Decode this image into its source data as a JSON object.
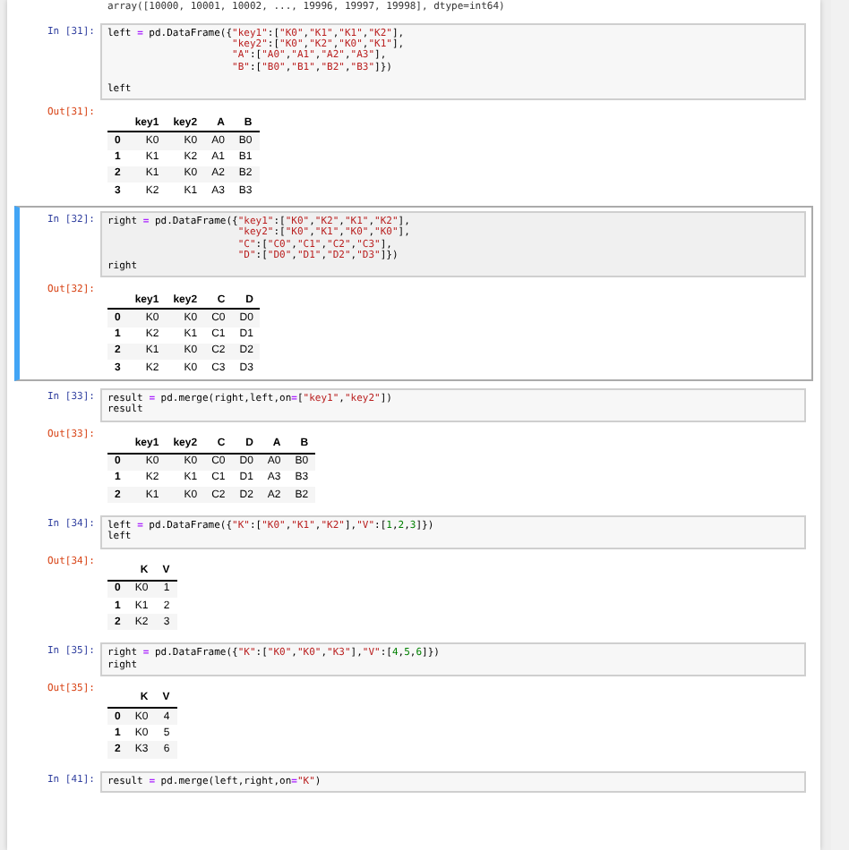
{
  "top_output": "array([10000, 10001, 10002, ..., 19996, 19997, 19998], dtype=int64)",
  "cells": [
    {
      "in_prompt": "In  [31]:",
      "selected": false,
      "code": "left = pd.DataFrame({\"key1\":[\"K0\",\"K1\",\"K1\",\"K2\"],\n                     \"key2\":[\"K0\",\"K2\",\"K0\",\"K1\"],\n                     \"A\":[\"A0\",\"A1\",\"A2\",\"A3\"],\n                     \"B\":[\"B0\",\"B1\",\"B2\",\"B3\"]})\n\nleft",
      "out_prompt": "Out[31]:",
      "table": {
        "columns": [
          "",
          "key1",
          "key2",
          "A",
          "B"
        ],
        "rows": [
          [
            "0",
            "K0",
            "K0",
            "A0",
            "B0"
          ],
          [
            "1",
            "K1",
            "K2",
            "A1",
            "B1"
          ],
          [
            "2",
            "K1",
            "K0",
            "A2",
            "B2"
          ],
          [
            "3",
            "K2",
            "K1",
            "A3",
            "B3"
          ]
        ]
      }
    },
    {
      "in_prompt": "In  [32]:",
      "selected": true,
      "code": "right = pd.DataFrame({\"key1\":[\"K0\",\"K2\",\"K1\",\"K2\"],\n                      \"key2\":[\"K0\",\"K1\",\"K0\",\"K0\"],\n                      \"C\":[\"C0\",\"C1\",\"C2\",\"C3\"],\n                      \"D\":[\"D0\",\"D1\",\"D2\",\"D3\"]})\nright",
      "out_prompt": "Out[32]:",
      "table": {
        "columns": [
          "",
          "key1",
          "key2",
          "C",
          "D"
        ],
        "rows": [
          [
            "0",
            "K0",
            "K0",
            "C0",
            "D0"
          ],
          [
            "1",
            "K2",
            "K1",
            "C1",
            "D1"
          ],
          [
            "2",
            "K1",
            "K0",
            "C2",
            "D2"
          ],
          [
            "3",
            "K2",
            "K0",
            "C3",
            "D3"
          ]
        ]
      }
    },
    {
      "in_prompt": "In  [33]:",
      "selected": false,
      "code": "result = pd.merge(right,left,on=[\"key1\",\"key2\"])\nresult",
      "out_prompt": "Out[33]:",
      "table": {
        "columns": [
          "",
          "key1",
          "key2",
          "C",
          "D",
          "A",
          "B"
        ],
        "rows": [
          [
            "0",
            "K0",
            "K0",
            "C0",
            "D0",
            "A0",
            "B0"
          ],
          [
            "1",
            "K2",
            "K1",
            "C1",
            "D1",
            "A3",
            "B3"
          ],
          [
            "2",
            "K1",
            "K0",
            "C2",
            "D2",
            "A2",
            "B2"
          ]
        ]
      }
    },
    {
      "in_prompt": "In  [34]:",
      "selected": false,
      "code": "left = pd.DataFrame({\"K\":[\"K0\",\"K1\",\"K2\"],\"V\":[1,2,3]})\nleft",
      "out_prompt": "Out[34]:",
      "table": {
        "columns": [
          "",
          "K",
          "V"
        ],
        "rows": [
          [
            "0",
            "K0",
            "1"
          ],
          [
            "1",
            "K1",
            "2"
          ],
          [
            "2",
            "K2",
            "3"
          ]
        ]
      }
    },
    {
      "in_prompt": "In  [35]:",
      "selected": false,
      "code": "right = pd.DataFrame({\"K\":[\"K0\",\"K0\",\"K3\"],\"V\":[4,5,6]})\nright",
      "out_prompt": "Out[35]:",
      "table": {
        "columns": [
          "",
          "K",
          "V"
        ],
        "rows": [
          [
            "0",
            "K0",
            "4"
          ],
          [
            "1",
            "K0",
            "5"
          ],
          [
            "2",
            "K3",
            "6"
          ]
        ]
      }
    },
    {
      "in_prompt": "In  [41]:",
      "selected": false,
      "code": "result = pd.merge(left,right,on=\"K\")"
    }
  ]
}
